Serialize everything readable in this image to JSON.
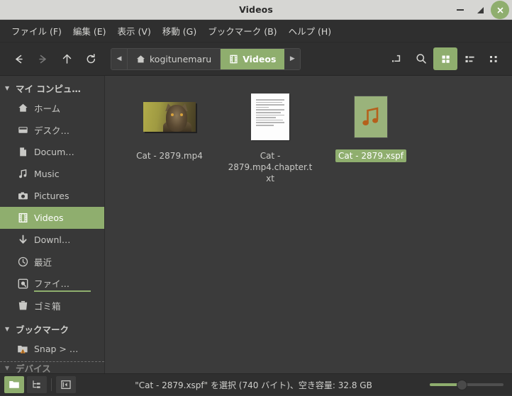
{
  "window": {
    "title": "Videos",
    "controls": {
      "minimize": "minimize",
      "maximize": "maximize",
      "close": "close"
    }
  },
  "menubar": {
    "items": [
      {
        "label": "ファイル (F)",
        "name": "menu-file"
      },
      {
        "label": "編集 (E)",
        "name": "menu-edit"
      },
      {
        "label": "表示 (V)",
        "name": "menu-view"
      },
      {
        "label": "移動 (G)",
        "name": "menu-go"
      },
      {
        "label": "ブックマーク (B)",
        "name": "menu-bookmarks"
      },
      {
        "label": "ヘルプ (H)",
        "name": "menu-help"
      }
    ]
  },
  "toolbar": {
    "back": "back-icon",
    "forward": "forward-icon",
    "up": "up-icon",
    "reload": "reload-icon",
    "pathbar": {
      "scroll_left": "◀",
      "scroll_right": "▶",
      "crumbs": [
        {
          "label": "kogitunemaru",
          "icon": "home-icon",
          "selected": false
        },
        {
          "label": "Videos",
          "icon": "film-icon",
          "selected": true
        }
      ]
    },
    "location_entry": "path-entry-icon",
    "search": "search-icon",
    "view_icon": "icon-view-icon",
    "view_list": "list-view-icon",
    "view_compact": "compact-view-icon"
  },
  "sidebar": {
    "groups": [
      {
        "label": "マイ コンピュ…",
        "name": "sidebar-group-my-computer",
        "items": [
          {
            "label": "ホーム",
            "icon": "home-icon",
            "name": "sidebar-item-home",
            "selected": false
          },
          {
            "label": "デスク…",
            "icon": "desktop-icon",
            "name": "sidebar-item-desktop",
            "selected": false
          },
          {
            "label": "Docum…",
            "icon": "document-icon",
            "name": "sidebar-item-documents",
            "selected": false
          },
          {
            "label": "Music",
            "icon": "music-icon",
            "name": "sidebar-item-music",
            "selected": false
          },
          {
            "label": "Pictures",
            "icon": "camera-icon",
            "name": "sidebar-item-pictures",
            "selected": false
          },
          {
            "label": "Videos",
            "icon": "film-icon",
            "name": "sidebar-item-videos",
            "selected": true
          },
          {
            "label": "Downl…",
            "icon": "download-icon",
            "name": "sidebar-item-downloads",
            "selected": false
          },
          {
            "label": "最近",
            "icon": "clock-icon",
            "name": "sidebar-item-recent",
            "selected": false
          },
          {
            "label": "ファイ…",
            "icon": "filesystem-icon",
            "name": "sidebar-item-filesystem",
            "selected": false,
            "underlined": true
          },
          {
            "label": "ゴミ箱",
            "icon": "trash-icon",
            "name": "sidebar-item-trash",
            "selected": false
          }
        ]
      },
      {
        "label": "ブックマーク",
        "name": "sidebar-group-bookmarks",
        "items": [
          {
            "label": "Snap > …",
            "icon": "folder-warning-icon",
            "name": "sidebar-item-snap",
            "selected": false
          }
        ]
      },
      {
        "label": "デバイス",
        "name": "sidebar-group-devices",
        "items": []
      }
    ]
  },
  "files": [
    {
      "name": "Cat - 2879.mp4",
      "thumb": "video-thumbnail",
      "selected": false,
      "element_name": "file-item-video"
    },
    {
      "name": "Cat - 2879.mp4.chapter.txt",
      "thumb": "text-document-icon",
      "selected": false,
      "element_name": "file-item-chapter-text"
    },
    {
      "name": "Cat - 2879.xspf",
      "thumb": "audio-playlist-icon",
      "selected": true,
      "element_name": "file-item-playlist"
    }
  ],
  "statusbar": {
    "buttons": [
      {
        "name": "status-button-icon-view",
        "icon": "folder-icon",
        "active": true
      },
      {
        "name": "status-button-tree-view",
        "icon": "tree-icon",
        "active": false
      },
      {
        "name": "status-button-toggle-sidebar",
        "icon": "sidebar-toggle-icon",
        "active": false
      }
    ],
    "text": "\"Cat - 2879.xspf\" を選択 (740 バイト)、空き容量: 32.8 GB",
    "zoom_slider": "zoom-slider"
  },
  "colors": {
    "accent": "#8fae6e",
    "window_bg": "#2f2f2f",
    "content_bg": "#3b3b3b",
    "sidebar_bg": "#383838",
    "titlebar_bg": "#d6d6d3",
    "text": "#c9c9c6"
  }
}
